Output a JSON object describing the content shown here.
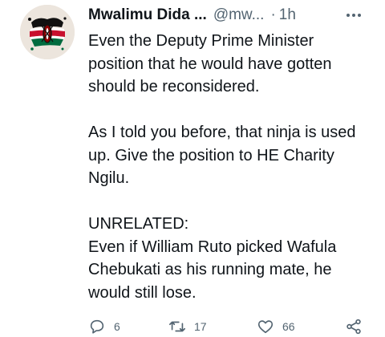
{
  "tweet": {
    "author_name": "Mwalimu Dida ...",
    "handle": "@mw...",
    "separator": "·",
    "time": "1h",
    "paragraphs": [
      "Even the Deputy Prime Minister position that he would have gotten should be reconsidered.",
      "As I told you before, that ninja is used up. Give the position to HE Charity Ngilu.",
      "UNRELATED:\nEven if William Ruto picked Wafula Chebukati as his running mate, he would still lose."
    ],
    "reply_count": "6",
    "retweet_count": "17",
    "like_count": "66"
  },
  "icons": {
    "more": "more-horizontal-icon",
    "reply": "reply-icon",
    "retweet": "retweet-icon",
    "like": "heart-icon",
    "share": "share-icon"
  },
  "colors": {
    "text": "#0f1419",
    "secondary": "#536471"
  }
}
